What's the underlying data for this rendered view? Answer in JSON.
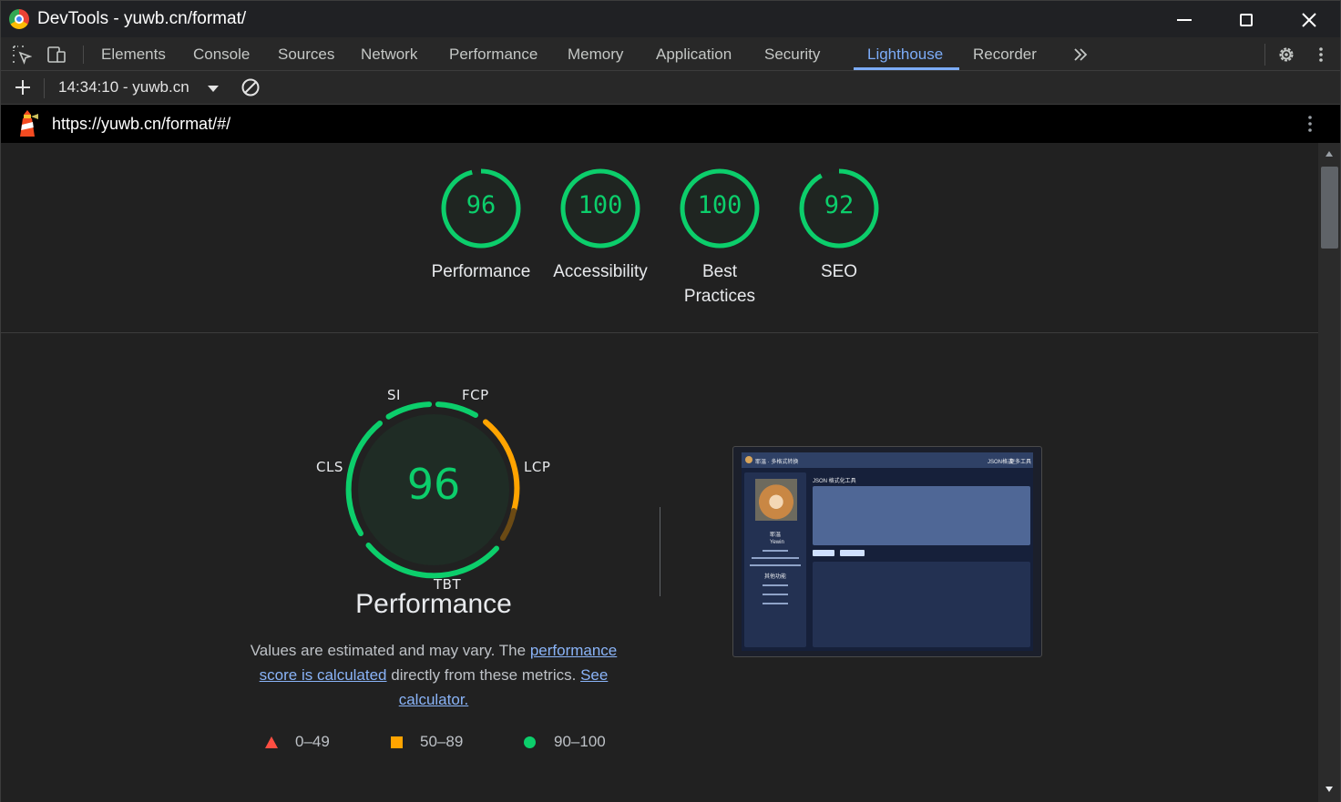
{
  "window": {
    "title": "DevTools - yuwb.cn/format/"
  },
  "tabs": [
    {
      "label": "Elements"
    },
    {
      "label": "Console"
    },
    {
      "label": "Sources"
    },
    {
      "label": "Network"
    },
    {
      "label": "Performance"
    },
    {
      "label": "Memory"
    },
    {
      "label": "Application"
    },
    {
      "label": "Security"
    },
    {
      "label": "Lighthouse",
      "active": true
    },
    {
      "label": "Recorder"
    }
  ],
  "report_selector": {
    "value": "14:34:10 - yuwb.cn"
  },
  "url": "https://yuwb.cn/format/#/",
  "categories": [
    {
      "score": "96",
      "score_value": 96,
      "label": "Performance"
    },
    {
      "score": "100",
      "score_value": 100,
      "label": "Accessibility"
    },
    {
      "score": "100",
      "score_value": 100,
      "label_line1": "Best",
      "label_line2": "Practices"
    },
    {
      "score": "92",
      "score_value": 92,
      "label": "SEO"
    }
  ],
  "performance": {
    "score": "96",
    "title": "Performance",
    "metrics": {
      "si": "SI",
      "fcp": "FCP",
      "lcp": "LCP",
      "tbt": "TBT",
      "cls": "CLS"
    },
    "desc_prefix": "Values are estimated and may vary. The ",
    "link1": "performance score is calculated",
    "desc_middle": " directly from these metrics. ",
    "link2": "See calculator."
  },
  "legend": [
    {
      "range": "0–49",
      "shape": "triangle",
      "color": "#ff4e42"
    },
    {
      "range": "50–89",
      "shape": "square",
      "color": "#ffa400"
    },
    {
      "range": "90–100",
      "shape": "circle",
      "color": "#0cce6b"
    }
  ],
  "colors": {
    "good": "#0cce6b",
    "average": "#ffa400",
    "accent": "#7cacf8"
  },
  "thumbnail": {
    "header": "耶温 · 多格式转换",
    "nav1": "JSON格式",
    "nav2": "更多工具",
    "panel_title": "JSON 格式化工具",
    "profile_name": "耶温",
    "profile_handle": "Yewin",
    "menu_title": "其他功能"
  }
}
